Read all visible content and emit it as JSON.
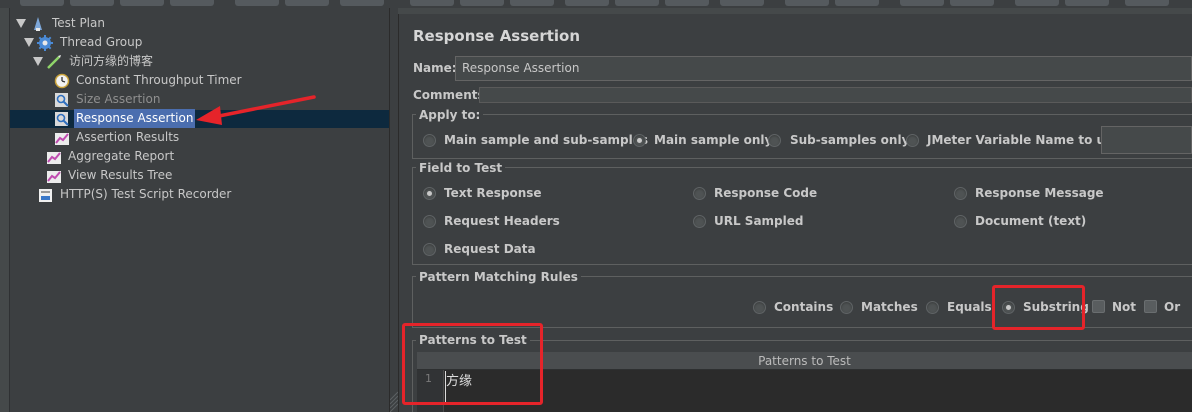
{
  "tree": {
    "items": [
      {
        "label": "Test Plan",
        "icon": "test-plan-icon"
      },
      {
        "label": "Thread Group",
        "icon": "gear-icon"
      },
      {
        "label": "访问方缘的博客",
        "icon": "http-sampler-icon"
      },
      {
        "label": "Constant Throughput Timer",
        "icon": "timer-icon"
      },
      {
        "label": "Size Assertion",
        "icon": "assertion-icon"
      },
      {
        "label": "Response Assertion",
        "icon": "assertion-icon"
      },
      {
        "label": "Assertion Results",
        "icon": "listener-icon"
      },
      {
        "label": "Aggregate Report",
        "icon": "listener-icon"
      },
      {
        "label": "View Results Tree",
        "icon": "listener-icon"
      },
      {
        "label": "HTTP(S) Test Script Recorder",
        "icon": "recorder-icon"
      }
    ]
  },
  "panel": {
    "title": "Response Assertion",
    "name_label": "Name:",
    "name_value": "Response Assertion",
    "comments_label": "Comments:"
  },
  "apply_to": {
    "title": "Apply to:",
    "options": [
      "Main sample and sub-samples",
      "Main sample only",
      "Sub-samples only",
      "JMeter Variable Name to use"
    ],
    "selected": "Main sample only"
  },
  "field_to_test": {
    "title": "Field to Test",
    "options": [
      "Text Response",
      "Response Code",
      "Response Message",
      "Request Headers",
      "URL Sampled",
      "Document (text)",
      "Request Data"
    ],
    "selected": "Text Response"
  },
  "pattern_rules": {
    "title": "Pattern Matching Rules",
    "options": [
      "Contains",
      "Matches",
      "Equals",
      "Substring"
    ],
    "selected": "Substring",
    "checks": [
      "Not",
      "Or"
    ]
  },
  "patterns": {
    "title": "Patterns to Test",
    "column_header": "Patterns to Test",
    "line_number": "1",
    "rows": [
      "方缘"
    ]
  },
  "colors": {
    "background": "#3c3f41",
    "selection": "#4b6eaf",
    "annotation_red": "#e5242a"
  }
}
